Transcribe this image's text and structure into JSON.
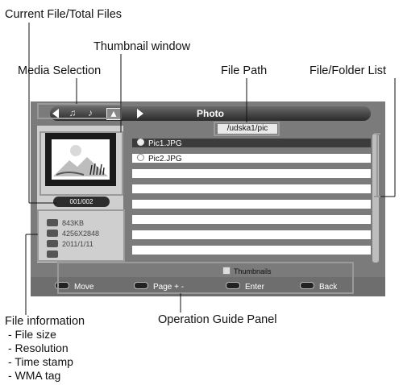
{
  "callouts": {
    "current_total": "Current File/Total Files",
    "thumbnail_window": "Thumbnail window",
    "media_selection": "Media Selection",
    "file_path": "File Path",
    "file_folder_list": "File/Folder List",
    "file_information": "File information",
    "operation_guide": "Operation Guide Panel",
    "info_items": [
      "- File size",
      "- Resolution",
      "- Time stamp",
      "- WMA tag"
    ]
  },
  "screen": {
    "title": "Photo",
    "path": "/udska1/pic",
    "counter": "001/002",
    "file_info": [
      "843KB",
      "4256X2848",
      "2011/1/11",
      ""
    ],
    "files": [
      {
        "name": "Pic1.JPG",
        "selected": true
      },
      {
        "name": "Pic2.JPG",
        "selected": false
      }
    ],
    "thumbnails_label": "Thumbnails",
    "guide": {
      "move": "Move",
      "page": "Page + -",
      "enter": "Enter",
      "back": "Back"
    }
  },
  "colors": {
    "screen_bg": "#7b7b7b",
    "selected_row": "#3c3c3c",
    "callout_frame": "#9a9a9a"
  }
}
